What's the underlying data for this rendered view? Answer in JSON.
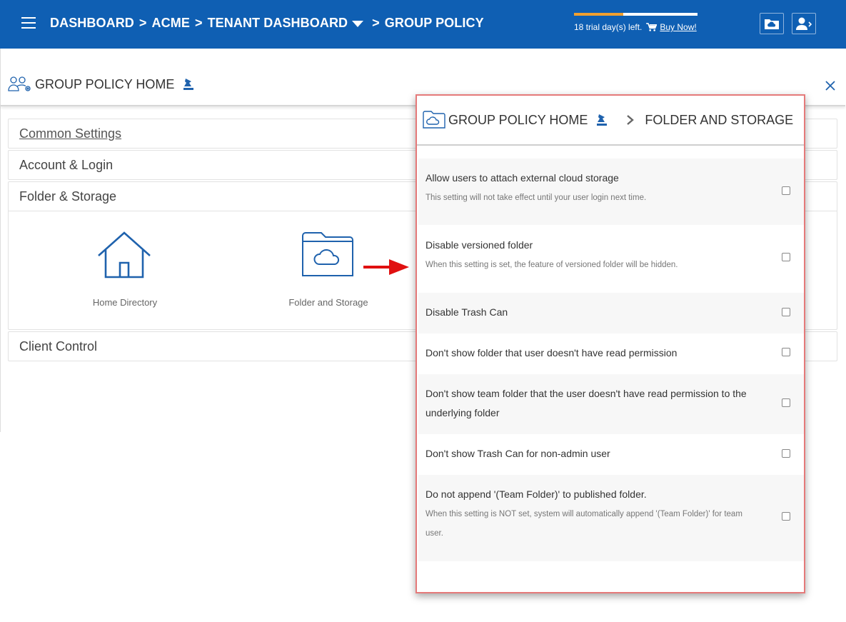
{
  "topbar": {
    "breadcrumb": [
      "DASHBOARD",
      "ACME",
      "TENANT DASHBOARD",
      "GROUP POLICY"
    ],
    "separator": ">",
    "trial_text": "18 trial day(s) left.",
    "buy_now": "Buy Now!",
    "trial_progress": 0.4,
    "colors": {
      "bar": "#0f5fb3",
      "progress": "#f0a030"
    }
  },
  "page": {
    "title": "GROUP POLICY HOME",
    "sections": [
      {
        "label": "Common Settings"
      },
      {
        "label": "Account & Login"
      },
      {
        "label": "Folder & Storage"
      },
      {
        "label": "Client Control"
      }
    ],
    "tiles": [
      {
        "label": "Home Directory",
        "icon": "house-icon"
      },
      {
        "label": "Folder and Storage",
        "icon": "cloud-folder-icon"
      }
    ]
  },
  "modal": {
    "home": "GROUP POLICY HOME",
    "current": "FOLDER AND STORAGE",
    "settings": [
      {
        "title": "Allow users to attach external cloud storage",
        "desc": "This setting will not take effect until your user login next time.",
        "checked": false
      },
      {
        "title": "Disable versioned folder",
        "desc": "When this setting is set, the feature of versioned folder will be hidden.",
        "checked": false
      },
      {
        "title": "Disable Trash Can",
        "desc": "",
        "checked": false
      },
      {
        "title": "Don't show folder that user doesn't have read permission",
        "desc": "",
        "checked": false
      },
      {
        "title": "Don't show team folder that the user doesn't have read permission to the underlying folder",
        "desc": "",
        "checked": false
      },
      {
        "title": "Don't show Trash Can for non-admin user",
        "desc": "",
        "checked": false
      },
      {
        "title": "Do not append '(Team Folder)' to published folder.",
        "desc": "When this setting is NOT set, system will automatically append '(Team Folder)' for team user.",
        "checked": false
      }
    ]
  }
}
